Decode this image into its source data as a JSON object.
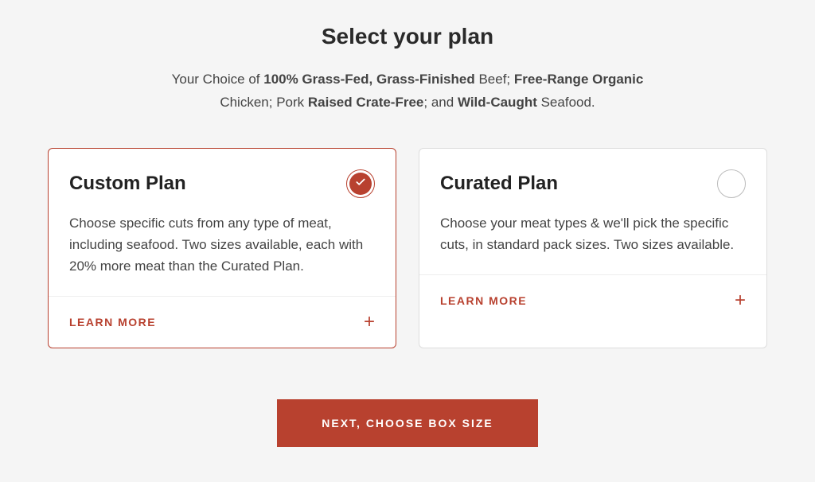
{
  "title": "Select your plan",
  "subtitle_parts": {
    "p1": "Your Choice of ",
    "b1": "100% Grass-Fed, Grass-Finished",
    "p2": " Beef; ",
    "b2": "Free-Range Organic",
    "p3": " Chicken; Pork ",
    "b3": "Raised Crate-Free",
    "p4": "; and ",
    "b4": "Wild-Caught",
    "p5": " Seafood."
  },
  "plans": {
    "custom": {
      "title": "Custom Plan",
      "description": "Choose specific cuts from any type of meat, including seafood. Two sizes available, each with 20% more meat than the Curated Plan.",
      "learn_more": "Learn More",
      "selected": true
    },
    "curated": {
      "title": "Curated Plan",
      "description": "Choose your meat types & we'll pick the specific cuts, in standard pack sizes. Two sizes available.",
      "learn_more": "Learn More",
      "selected": false
    }
  },
  "cta": "Next, Choose Box Size"
}
